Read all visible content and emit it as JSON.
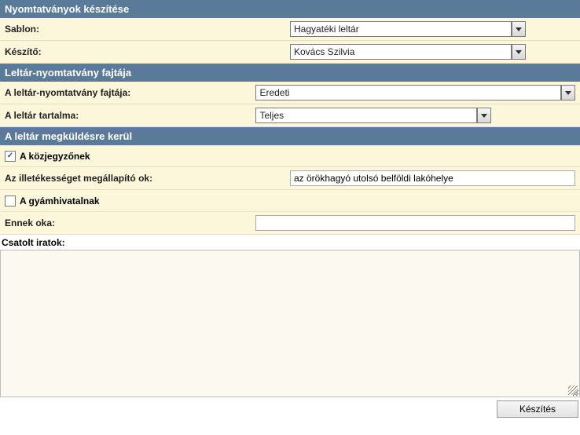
{
  "section1": {
    "title": "Nyomtatványok készítése",
    "rows": {
      "sablon_label": "Sablon:",
      "sablon_value": "Hagyatéki leltár",
      "keszito_label": "Készítő:",
      "keszito_value": "Kovács Szilvia"
    }
  },
  "section2": {
    "title": "Leltár-nyomtatvány fajtája",
    "rows": {
      "fajta_label": "A leltár-nyomtatvány fajtája:",
      "fajta_value": "Eredeti",
      "tartalma_label": "A leltár tartalma:",
      "tartalma_value": "Teljes"
    }
  },
  "section3": {
    "title": "A leltár megküldésre kerül",
    "rows": {
      "kozjegyzonek_checked": true,
      "kozjegyzonek_label": "A közjegyzőnek",
      "illetekesseg_label": "Az illetékességet megállapító ok:",
      "illetekesseg_value": "az örökhagyó utolsó belföldi lakóhelye",
      "gyamhivatalnak_checked": false,
      "gyamhivatalnak_label": "A gyámhivatalnak",
      "ennek_oka_label": "Ennek oka:",
      "ennek_oka_value": ""
    }
  },
  "attachments": {
    "label": "Csatolt iratok:",
    "content": ""
  },
  "footer": {
    "submit_label": "Készítés"
  }
}
